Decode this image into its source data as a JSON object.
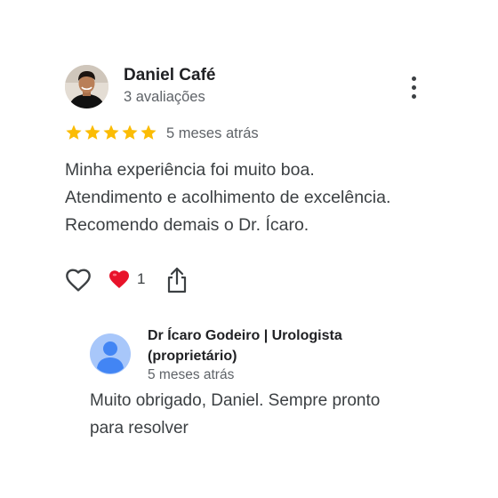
{
  "review": {
    "author": {
      "name": "Daniel Café",
      "reviews_count": "3 avaliações"
    },
    "rating": 5,
    "max_rating": 5,
    "date": "5 meses atrás",
    "text_lines": [
      "Minha experiência foi muito boa.",
      "Atendimento e acolhimento de excelência.",
      "Recomendo demais o Dr. Ícaro."
    ],
    "reaction_count": "1"
  },
  "owner_reply": {
    "name": "Dr Ícaro Godeiro | Urologista (proprietário)",
    "date": "5 meses atrás",
    "text_lines": [
      "Muito obrigado, Daniel. Sempre pronto",
      "para resolver"
    ]
  },
  "colors": {
    "star": "#fbbc04",
    "heart_filled": "#e8132a",
    "owner_avatar_bg": "#a8c7fa",
    "owner_avatar_fg": "#4285f4"
  },
  "icons": {
    "more": "more-vert-icon",
    "like": "heart-outline-icon",
    "reaction": "heart-filled-icon",
    "share": "share-icon",
    "star": "star-icon",
    "owner_avatar": "person-icon"
  }
}
